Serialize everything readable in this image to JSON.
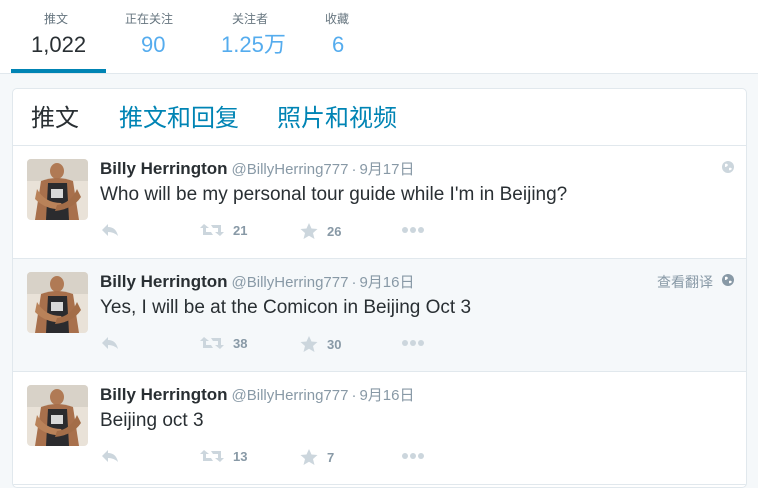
{
  "stats": [
    {
      "label": "推文",
      "value": "1,022",
      "active": true
    },
    {
      "label": "正在关注",
      "value": "90",
      "active": false
    },
    {
      "label": "关注者",
      "value": "1.25万",
      "active": false
    },
    {
      "label": "收藏",
      "value": "6",
      "active": false
    }
  ],
  "tabs": [
    "推文",
    "推文和回复",
    "照片和视频"
  ],
  "colors": {
    "accent": "#0084b4",
    "link": "#55acee",
    "muted": "#8899a6",
    "text": "#292f33"
  },
  "tweets": [
    {
      "name": "Billy Herrington",
      "handle": "@BillyHerring777",
      "time": "9月17日",
      "text": "Who will be my personal tour guide while I'm in Beijing?",
      "translate": "",
      "retweets": "21",
      "favorites": "26"
    },
    {
      "name": "Billy Herrington",
      "handle": "@BillyHerring777",
      "time": "9月16日",
      "text": "Yes, I will be at the Comicon in Beijing Oct 3",
      "translate": "查看翻译",
      "retweets": "38",
      "favorites": "30"
    },
    {
      "name": "Billy Herrington",
      "handle": "@BillyHerring777",
      "time": "9月16日",
      "text": "Beijing oct 3",
      "translate": "",
      "retweets": "13",
      "favorites": "7"
    }
  ]
}
